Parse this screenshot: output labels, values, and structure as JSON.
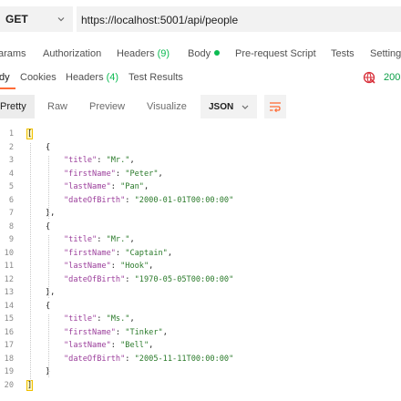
{
  "request": {
    "method": "GET",
    "url": "https://localhost:5001/api/people"
  },
  "request_tabs": [
    {
      "label": "arams"
    },
    {
      "label": "Authorization"
    },
    {
      "label": "Headers",
      "count": "(9)"
    },
    {
      "label": "Body"
    },
    {
      "label": "Pre-request Script"
    },
    {
      "label": "Tests"
    },
    {
      "label": "Setting"
    }
  ],
  "response_tabs": [
    {
      "label": "dy"
    },
    {
      "label": "Cookies"
    },
    {
      "label": "Headers",
      "count": "(4)"
    },
    {
      "label": "Test Results"
    }
  ],
  "status": "200",
  "format": {
    "modes": [
      "Pretty",
      "Raw",
      "Preview",
      "Visualize"
    ],
    "language": "JSON"
  },
  "body_lines": [
    {
      "n": "1",
      "indent": 0,
      "text": "["
    },
    {
      "n": "2",
      "indent": 1,
      "text": "{"
    },
    {
      "n": "3",
      "indent": 2,
      "key": "\"title\"",
      "value": "\"Mr.\"",
      "comma": ","
    },
    {
      "n": "4",
      "indent": 2,
      "key": "\"firstName\"",
      "value": "\"Peter\"",
      "comma": ","
    },
    {
      "n": "5",
      "indent": 2,
      "key": "\"lastName\"",
      "value": "\"Pan\"",
      "comma": ","
    },
    {
      "n": "6",
      "indent": 2,
      "key": "\"dateOfBirth\"",
      "value": "\"2000-01-01T00:00:00\"",
      "comma": ""
    },
    {
      "n": "7",
      "indent": 1,
      "text": "},"
    },
    {
      "n": "8",
      "indent": 1,
      "text": "{"
    },
    {
      "n": "9",
      "indent": 2,
      "key": "\"title\"",
      "value": "\"Mr.\"",
      "comma": ","
    },
    {
      "n": "10",
      "indent": 2,
      "key": "\"firstName\"",
      "value": "\"Captain\"",
      "comma": ","
    },
    {
      "n": "11",
      "indent": 2,
      "key": "\"lastName\"",
      "value": "\"Hook\"",
      "comma": ","
    },
    {
      "n": "12",
      "indent": 2,
      "key": "\"dateOfBirth\"",
      "value": "\"1970-05-05T00:00:00\"",
      "comma": ""
    },
    {
      "n": "13",
      "indent": 1,
      "text": "},"
    },
    {
      "n": "14",
      "indent": 1,
      "text": "{"
    },
    {
      "n": "15",
      "indent": 2,
      "key": "\"title\"",
      "value": "\"Ms.\"",
      "comma": ","
    },
    {
      "n": "16",
      "indent": 2,
      "key": "\"firstName\"",
      "value": "\"Tinker\"",
      "comma": ","
    },
    {
      "n": "17",
      "indent": 2,
      "key": "\"lastName\"",
      "value": "\"Bell\"",
      "comma": ","
    },
    {
      "n": "18",
      "indent": 2,
      "key": "\"dateOfBirth\"",
      "value": "\"2005-11-11T00:00:00\"",
      "comma": ""
    },
    {
      "n": "19",
      "indent": 1,
      "text": "}"
    },
    {
      "n": "20",
      "indent": 0,
      "text": "]"
    }
  ],
  "icons": {
    "method_dropdown": "chevron-down-icon",
    "network": "globe-icon",
    "json_dropdown": "chevron-down-icon",
    "wrap": "wrap-lines-icon"
  },
  "colors": {
    "accent": "#ff6c37",
    "success": "#0cbb52",
    "json_key": "#9b3e9b",
    "json_value": "#2a7a2a"
  }
}
